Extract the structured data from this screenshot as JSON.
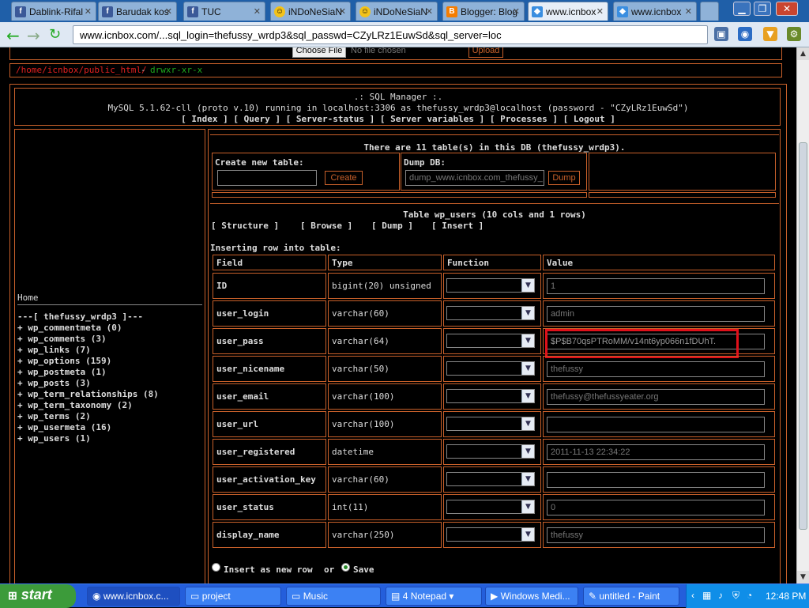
{
  "browser": {
    "tabs": [
      {
        "label": "Dablink-Rifal",
        "icon": "facebook-icon"
      },
      {
        "label": "Barudak kos",
        "icon": "facebook-icon"
      },
      {
        "label": "TUC",
        "icon": "facebook-icon"
      },
      {
        "label": "iNDoNeSiaN",
        "icon": "smiley-icon"
      },
      {
        "label": "iNDoNeSiaN",
        "icon": "smiley-icon"
      },
      {
        "label": "Blogger: Blog",
        "icon": "blogger-icon"
      },
      {
        "label": "www.icnbox",
        "icon": "globe-icon"
      },
      {
        "label": "www.icnbox",
        "icon": "globe-icon"
      }
    ],
    "url": "www.icnbox.com/...sql_login=thefussy_wrdp3&sql_passwd=CZyLRz1EuwSd&sql_server=loc"
  },
  "upload": {
    "choose_label": "Choose File",
    "no_file": "No file chosen",
    "upload_label": "Upload"
  },
  "path": {
    "dir": "/home/icnbox/public_html/",
    "sep": " - ",
    "perms": "drwxr-xr-x"
  },
  "sql": {
    "header": ".: SQL Manager :.",
    "server_info": "MySQL 5.1.62-cll (proto v.10) running in localhost:3306 as thefussy_wrdp3@localhost (password - \"CZyLRz1EuwSd\")",
    "nav": [
      "[ Index ]",
      "[ Query ]",
      "[ Server-status ]",
      "[ Server variables ]",
      "[ Processes ]",
      "[ Logout ]"
    ]
  },
  "sidebar": {
    "home": "Home",
    "db_title": "---[ thefussy_wrdp3 ]---",
    "tables": [
      "+ wp_commentmeta (0)",
      "+ wp_comments (3)",
      "+ wp_links (7)",
      "+ wp_options (159)",
      "+ wp_postmeta (1)",
      "+ wp_posts (3)",
      "+ wp_term_relationships (8)",
      "+ wp_term_taxonomy (2)",
      "+ wp_terms (2)",
      "+ wp_usermeta (16)",
      "+ wp_users (1)"
    ]
  },
  "main": {
    "summary": "There are 11 table(s) in this DB (thefussy_wrdp3).",
    "create_label": "Create new table:",
    "create_btn": "Create",
    "dump_label": "Dump DB:",
    "dump_value": "dump_www.icnbox.com_thefussy_",
    "dump_btn": "Dump",
    "table_title": "Table wp_users (10 cols and 1 rows)",
    "actions": [
      "[ Structure ]",
      "[ Browse ]",
      "[ Dump ]",
      "[ Insert ]"
    ],
    "inserting": "Inserting row into table:",
    "columns": [
      "Field",
      "Type",
      "Function",
      "Value"
    ],
    "rows": [
      {
        "field": "ID",
        "type": "bigint(20) unsigned",
        "value": "1"
      },
      {
        "field": "user_login",
        "type": "varchar(60)",
        "value": "admin"
      },
      {
        "field": "user_pass",
        "type": "varchar(64)",
        "value": "$P$B70qsPTRoMM/v14nt6yp066n1fDUhT."
      },
      {
        "field": "user_nicename",
        "type": "varchar(50)",
        "value": "thefussy"
      },
      {
        "field": "user_email",
        "type": "varchar(100)",
        "value": "thefussy@thefussyeater.org"
      },
      {
        "field": "user_url",
        "type": "varchar(100)",
        "value": ""
      },
      {
        "field": "user_registered",
        "type": "datetime",
        "value": "2011-11-13 22:34:22"
      },
      {
        "field": "user_activation_key",
        "type": "varchar(60)",
        "value": ""
      },
      {
        "field": "user_status",
        "type": "int(11)",
        "value": "0"
      },
      {
        "field": "display_name",
        "type": "varchar(250)",
        "value": "thefussy"
      }
    ],
    "insert_new": "Insert as new row",
    "or": "or",
    "save": "Save",
    "highlight_color": "#e0101a"
  },
  "taskbar": {
    "start": "start",
    "tasks": [
      "www.icnbox.c...",
      "project",
      "Music",
      "4 Notepad",
      "Windows Medi...",
      "untitled - Paint"
    ],
    "time": "12:48 PM"
  }
}
